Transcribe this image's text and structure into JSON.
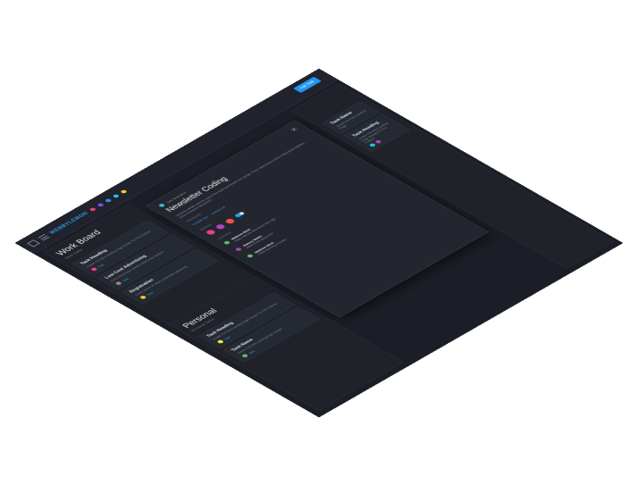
{
  "topbar": {
    "brand": "WEBBYLEMON",
    "add_button": "Add Task",
    "dots": [
      "#ec407a",
      "#7c4dff",
      "#2196f3",
      "#26c6da",
      "#ffca28"
    ]
  },
  "board": {
    "title": "Work Board",
    "subtitle": "Work Tasks",
    "cards": [
      {
        "title": "Task Heading",
        "desc": "Create The New Landing Page Design For The Feature",
        "link": "Task"
      },
      {
        "title": "Low Cost Advertising",
        "desc": "Proin ullamcorper pretium Maecenas dapibus",
        "link": "Task"
      },
      {
        "title": "Registration",
        "desc": "Lorem ipsum sit amet consectetur adipiscing",
        "link": "Task"
      }
    ]
  },
  "personal": {
    "title": "Personal",
    "subtitle": "Personal Tasks",
    "cards": [
      {
        "title": "Task Heading",
        "desc": "Create The New Landing Page Design For The Feature",
        "link": "Task"
      },
      {
        "title": "Task Name",
        "desc": "Create The New Landing Page Design",
        "link": "Task"
      }
    ]
  },
  "modal": {
    "author": "Task Information",
    "title": "Newsletter Coding",
    "desc": "Send the details and the copy to the team and finalize the design. Proin ullamcorper pretium Maecenas dapibus, lectus id laoreet elementum.",
    "attachments_label": "Attachments",
    "attachments": [
      "Template.psd",
      "Sample.pdf"
    ],
    "members_label": "Members",
    "comments_label": "Comments",
    "comments": [
      {
        "name": "Mathew Stick",
        "text": "Hello I like the idea about new logo"
      },
      {
        "name": "Stacey Watts",
        "text": "What is this about this?"
      },
      {
        "name": "Mathew Stick",
        "text": "I think the thing is ready"
      }
    ]
  },
  "right_cards": [
    {
      "title": "Task Name",
      "desc": "Create The New Landing Page"
    },
    {
      "title": "Task Heading",
      "desc": "Create The New Landing Page Design For The Feature"
    }
  ]
}
